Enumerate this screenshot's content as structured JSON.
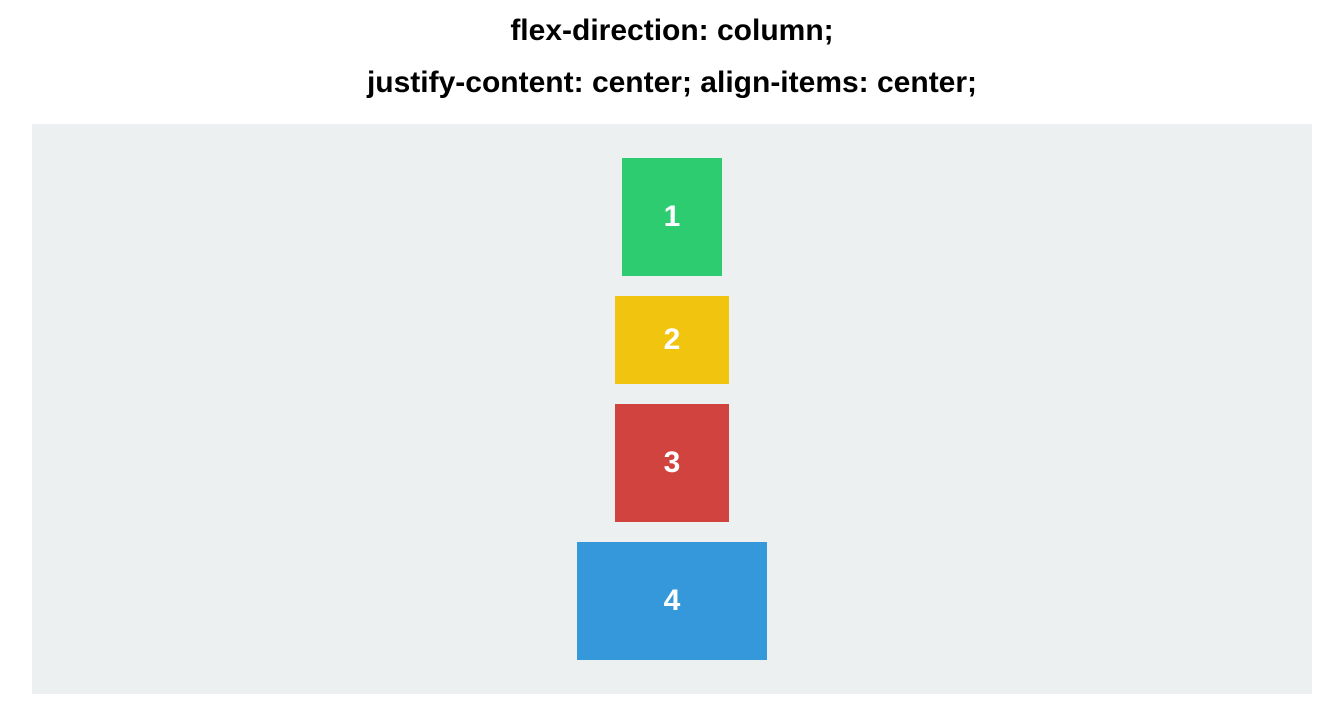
{
  "headings": {
    "line1": "flex-direction: column;",
    "line2": "justify-content: center; align-items: center;"
  },
  "container": {
    "background": "#ecf0f1"
  },
  "items": [
    {
      "label": "1",
      "color": "#2ecc71"
    },
    {
      "label": "2",
      "color": "#f1c40f"
    },
    {
      "label": "3",
      "color": "#d0433e"
    },
    {
      "label": "4",
      "color": "#3498db"
    }
  ]
}
